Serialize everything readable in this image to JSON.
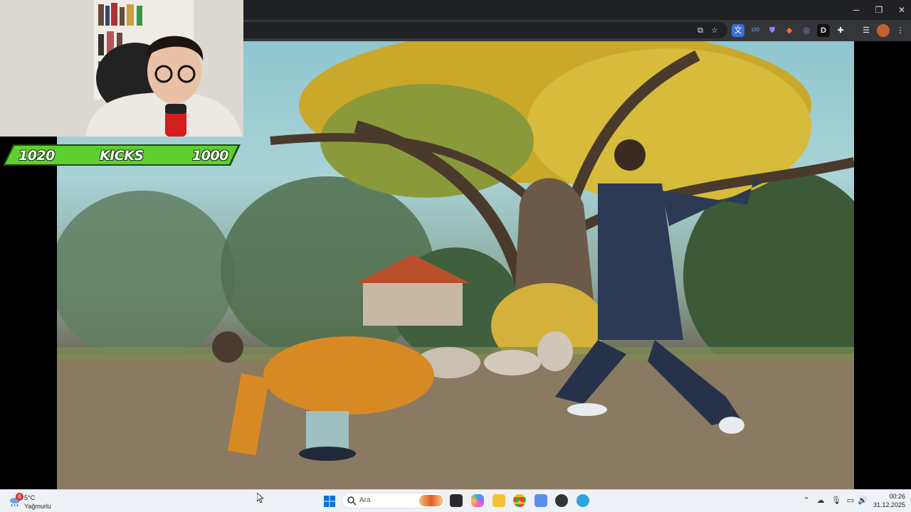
{
  "window": {
    "minimize_glyph": "─",
    "maximize_glyph": "❐",
    "close_glyph": "✕"
  },
  "browser_toolbar": {
    "icons": [
      "cast-icon",
      "bookmark-star-icon",
      "translate-icon",
      "extension-badge-icon",
      "shield-extension-icon",
      "fox-extension-icon",
      "swirl-extension-icon",
      "d-extension-icon",
      "puzzle-extensions-icon",
      "reading-list-icon",
      "profile-avatar-icon",
      "more-menu-icon"
    ],
    "badge_count": "120",
    "d_letter": "D"
  },
  "score_banner": {
    "left_score": "1020",
    "title": "KICKS",
    "right_score": "1000",
    "color": "#5fcf2f"
  },
  "taskbar": {
    "weather": {
      "badge": "6",
      "temperature": "5°C",
      "description": "Yağmurlu"
    },
    "search": {
      "placeholder": "Ara"
    },
    "apps": [
      "file-explorer-icon",
      "copilot-icon",
      "folder-icon",
      "chrome-icon",
      "snipping-tool-icon",
      "media-app-icon",
      "telegram-icon"
    ],
    "clock": {
      "time": "00:26",
      "date": "31.12.2025"
    }
  }
}
